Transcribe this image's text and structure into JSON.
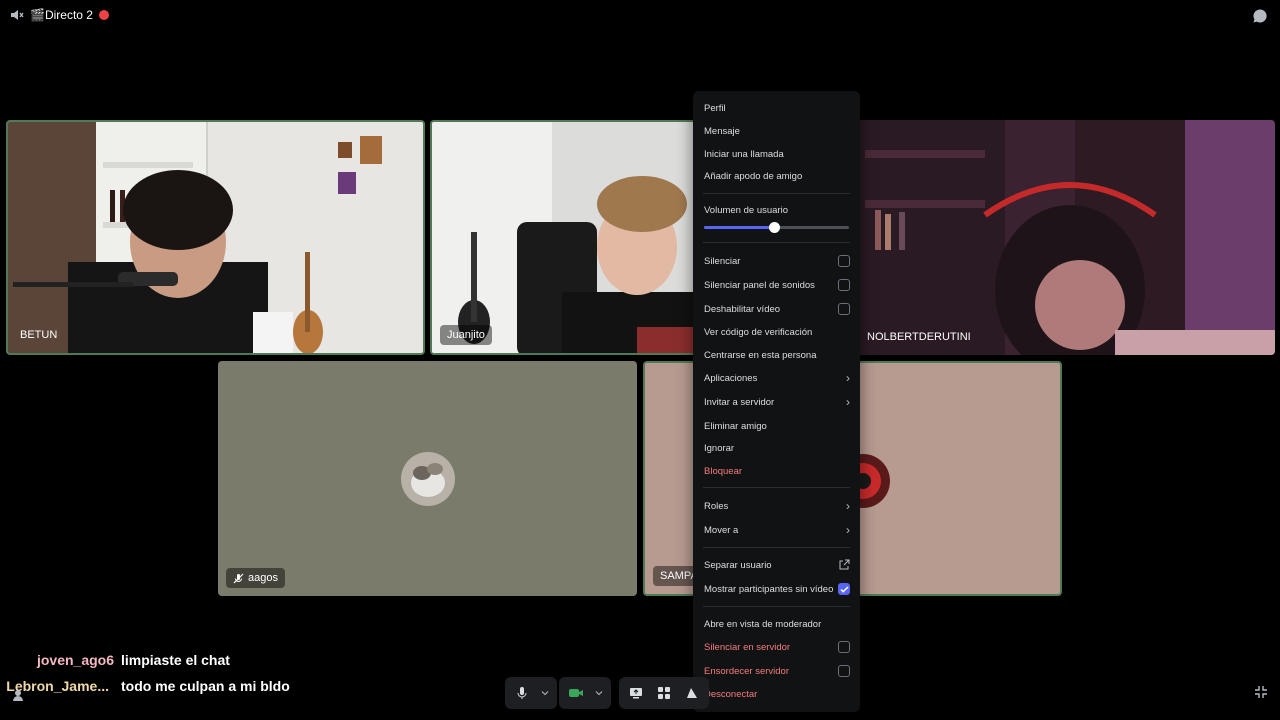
{
  "header": {
    "channel_name": "🎬Directo 2"
  },
  "tiles": [
    {
      "name": "BETUN"
    },
    {
      "name": "Juanjito"
    },
    {
      "name": "NOLBERTDERUTINI"
    },
    {
      "name": "aagos"
    },
    {
      "name": "SAMPAR"
    }
  ],
  "context_menu": {
    "profile": "Perfil",
    "message": "Mensaje",
    "start_call": "Iniciar una llamada",
    "add_nickname": "Añadir apodo de amigo",
    "user_volume": "Volumen de usuario",
    "user_volume_level": 0.48,
    "mute": "Silenciar",
    "mute_soundboard": "Silenciar panel de sonidos",
    "disable_video": "Deshabilitar vídeo",
    "verify_code": "Ver código de verificación",
    "focus": "Centrarse en esta persona",
    "apps": "Aplicaciones",
    "invite": "Invitar a servidor",
    "remove_friend": "Eliminar amigo",
    "ignore": "Ignorar",
    "block": "Bloquear",
    "roles": "Roles",
    "move_to": "Mover a",
    "pop_out": "Separar usuario",
    "show_no_video": "Mostrar participantes sin vídeo",
    "moderator_view": "Abre en vista de moderador",
    "server_mute": "Silenciar en servidor",
    "server_deafen": "Ensordecer servidor",
    "disconnect": "Desconectar"
  },
  "chat": [
    {
      "user": "joven_ago6",
      "message": "limpiaste el chat",
      "color": "#f3b8c0"
    },
    {
      "user": "Lebron_Jame...",
      "message": "todo me culpan a mi bldo",
      "color": "#f0d9a8"
    }
  ],
  "colors": {
    "accent": "#5865f2",
    "danger": "#f47b7d",
    "live": "#ed4245",
    "speaking": "#4f7a55"
  }
}
